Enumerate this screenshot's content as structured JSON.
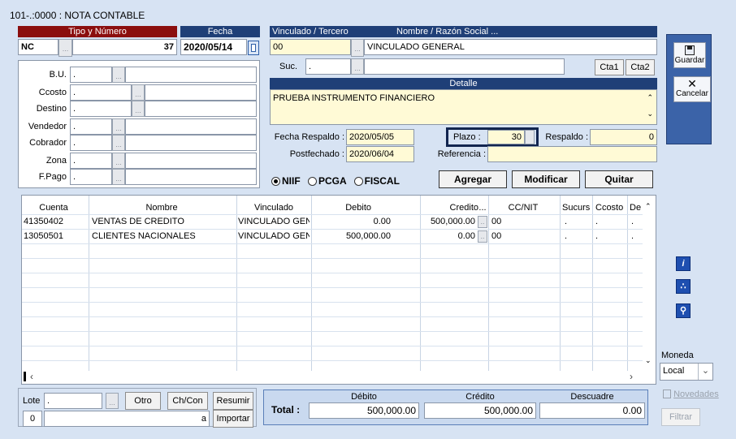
{
  "window": {
    "title": "101-.:0000 : NOTA CONTABLE"
  },
  "header": {
    "tipo_numero_label": "Tipo y Número",
    "fecha_label": "Fecha",
    "tipo": "NC",
    "numero": "37",
    "fecha": "2020/05/14",
    "vinculado_label": "Vinculado / Tercero",
    "nombre_label": "Nombre / Razón Social ...",
    "vinculado_code": "00",
    "vinculado_name": "VINCULADO GENERAL",
    "suc_label": "Suc.",
    "suc_value": ".",
    "cta1": "Cta1",
    "cta2": "Cta2",
    "detalle_label": "Detalle",
    "detalle_value": "PRUEBA INSTRUMENTO FINANCIERO"
  },
  "left_fields": [
    {
      "label": "B.U.",
      "value": "."
    },
    {
      "label": "Ccosto",
      "value": "."
    },
    {
      "label": "Destino",
      "value": "."
    },
    {
      "label": "Vendedor",
      "value": "."
    },
    {
      "label": "Cobrador",
      "value": "."
    },
    {
      "label": "Zona",
      "value": "."
    },
    {
      "label": "F.Pago",
      "value": "."
    }
  ],
  "dates": {
    "fecha_respaldo_label": "Fecha Respaldo :",
    "fecha_respaldo": "2020/05/05",
    "postfechado_label": "Postfechado :",
    "postfechado": "2020/06/04",
    "plazo_label": "Plazo :",
    "plazo": "30",
    "respaldo_label": "Respaldo :",
    "respaldo": "0",
    "referencia_label": "Referencia :",
    "referencia": ""
  },
  "standards": {
    "niif": "NIIF",
    "pcga": "PCGA",
    "fiscal": "FISCAL",
    "selected": "NIIF"
  },
  "actions": {
    "agregar": "Agregar",
    "modificar": "Modificar",
    "quitar": "Quitar"
  },
  "side": {
    "guardar": "Guardar",
    "cancelar": "Cancelar",
    "moneda_label": "Moneda",
    "moneda_value": "Local",
    "novedades": "Novedades",
    "filtrar": "Filtrar"
  },
  "grid": {
    "columns": [
      "Cuenta",
      "Nombre",
      "Vinculado",
      "Debito",
      "Credito",
      "...",
      "CC/NIT",
      "Sucurs",
      "Ccosto",
      "De"
    ],
    "rows": [
      {
        "cuenta": "41350402",
        "nombre": "VENTAS DE CREDITO",
        "vinculado": "VINCULADO GENE",
        "debito": "0.00",
        "credito": "500,000.00",
        "dots": "..",
        "ccnit": "00",
        "sucurs": ".",
        "ccosto": ".",
        "de": "."
      },
      {
        "cuenta": "13050501",
        "nombre": "CLIENTES NACIONALES",
        "vinculado": "VINCULADO GENE",
        "debito": "500,000.00",
        "credito": "0.00",
        "dots": "..",
        "ccnit": "00",
        "sucurs": ".",
        "ccosto": ".",
        "de": "."
      }
    ]
  },
  "footer": {
    "lote_label": "Lote",
    "lote_value": ".",
    "otro": "Otro",
    "chcon": "Ch/Con",
    "resumir": "Resumir",
    "importar": "Importar",
    "count": "0",
    "a_value": "a",
    "total_label": "Total :",
    "debito_label": "Débito",
    "credito_label": "Crédito",
    "descuadre_label": "Descuadre",
    "total_debito": "500,000.00",
    "total_credito": "500,000.00",
    "descuadre": "0.00"
  }
}
